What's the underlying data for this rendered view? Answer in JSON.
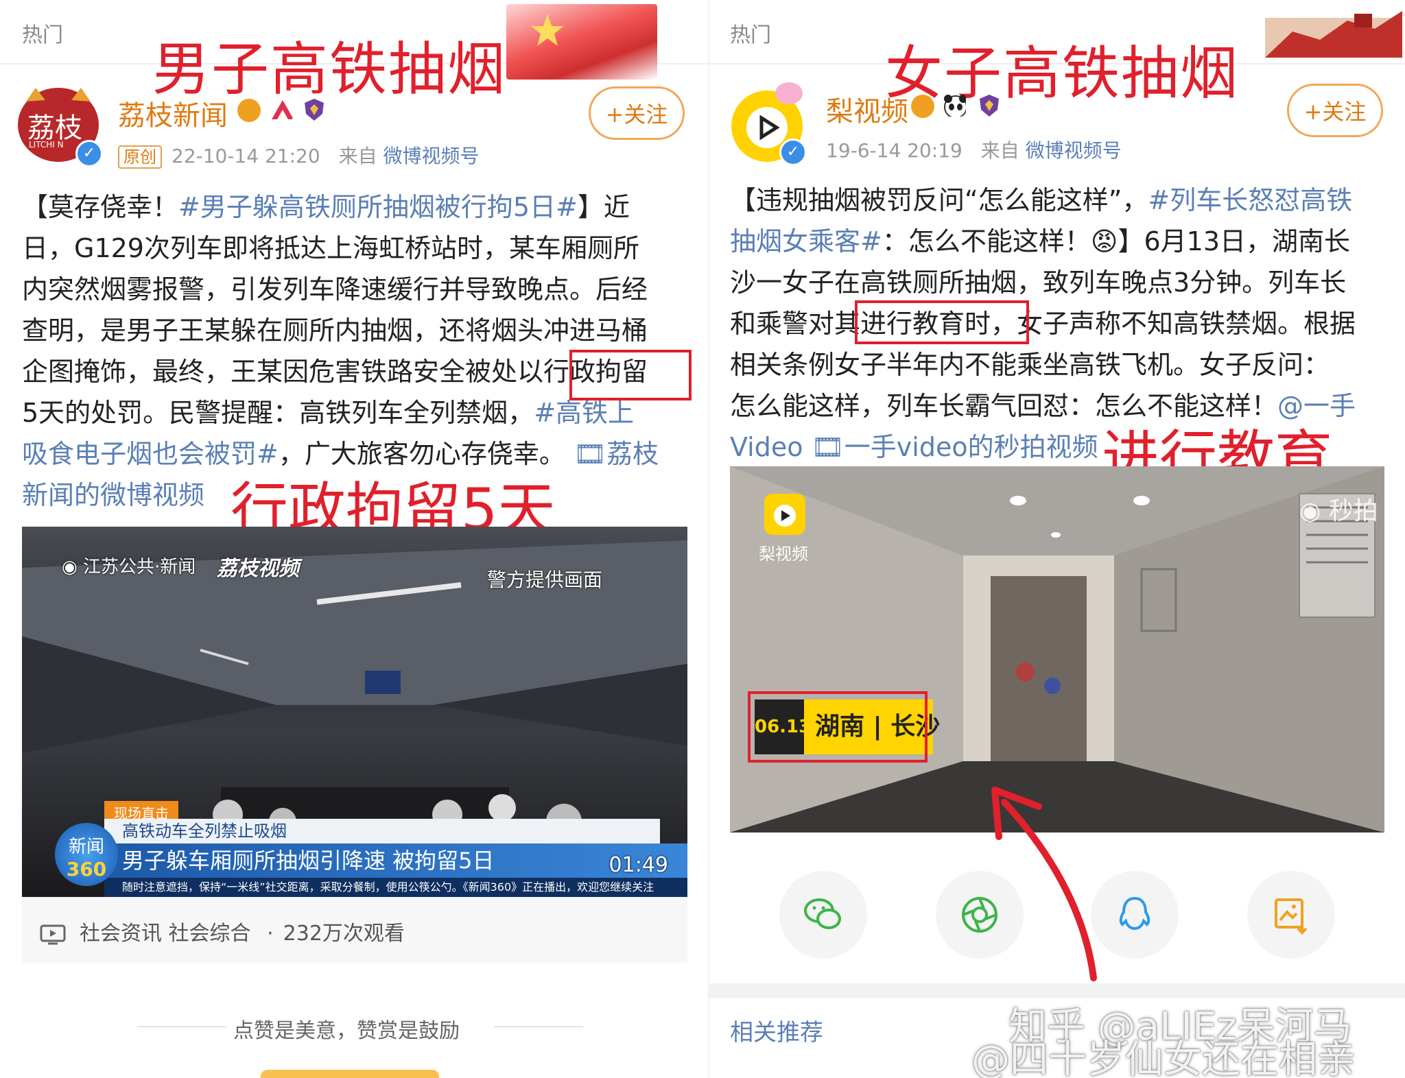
{
  "left": {
    "hot_label": "热门",
    "overlay_title": "男子高铁抽烟",
    "account": {
      "name": "荔枝新闻",
      "avatar_text": "荔枝",
      "avatar_sub": "LITCHI N"
    },
    "follow_label": "+关注",
    "original_badge": "原创",
    "timestamp": "22-10-14 21:20",
    "from_label": "来自",
    "source": "微博视频号",
    "body_lines": [
      [
        "【莫存侥幸！",
        "#男子躲高铁厕所抽烟被行拘5日#",
        "】近"
      ],
      [
        "日，G129次列车即将抵达上海虹桥站时，某车厢厕所"
      ],
      [
        "内突然烟雾报警，引发列车降速缓行并导致晚点。后经"
      ],
      [
        "查明，是男子王某躲在厕所内抽烟，还将烟头冲进马桶"
      ],
      [
        "企图掩饰，最终，王某因危害铁路安全被处以",
        "行政拘留"
      ],
      [
        "5天的处罚。民警提醒：高铁列车全列禁烟，",
        "#高铁上"
      ],
      [
        "吸食电子烟也会被罚#",
        "，广大旅客勿心存侥幸。",
        " 🎞荔枝"
      ],
      [
        "新闻的微博视频"
      ]
    ],
    "annotation": "行政拘留5天",
    "video": {
      "logo1": "江苏公共·新闻",
      "logo2": "荔枝视频",
      "police_caption": "警方提供画面",
      "live_tag": "现场直击",
      "subheadline": "高铁动车全列禁止吸烟",
      "headline": "男子躲车厢厕所抽烟引降速 被拘留5日",
      "ticker": "随时注意遮挡，保持“一米线”社交距离，采取分餐制，使用公筷公勺。《新闻360》正在播出，欢迎您继续关注",
      "news_logo_top": "新闻",
      "news_logo_bottom": "360",
      "duration": "01:49"
    },
    "video_category": "社会资讯 社会综合",
    "dot": "·",
    "views": "232万次观看",
    "bottom_hint": "点赞是美意，赞赏是鼓励"
  },
  "right": {
    "hot_label": "热门",
    "overlay_title": "女子高铁抽烟",
    "account": {
      "name": "梨视频"
    },
    "follow_label": "+关注",
    "timestamp": "19-6-14 20:19",
    "from_label": "来自",
    "source": "微博视频号",
    "body_lines": [
      [
        "【违规抽烟被罚反问“怎么能这样”，",
        "#列车长怒怼高铁"
      ],
      [
        "抽烟女乘客#",
        "：怎么不能这样！😡】6月13日，湖南长"
      ],
      [
        "沙一女子在高铁厕所抽烟，致列车晚点3分钟。列车长"
      ],
      [
        "和乘警对其",
        "进行教育时",
        "，女子声称不知高铁禁烟。根据"
      ],
      [
        "相关条例女子半年内不能乘坐高铁飞机。女子反问："
      ],
      [
        "怎么能这样，列车长霸气回怼：怎么不能这样！",
        "@一手"
      ],
      [
        "Video",
        " 🎞一手video的秒拍视频"
      ]
    ],
    "annotation": "进行教育",
    "video": {
      "logo": "梨视频",
      "watermark": "秒拍",
      "date": "06.13",
      "location": "湖南 | 长沙"
    },
    "related": "相关推荐",
    "watermark_zhihu": "知乎 @aLIEz呆河马",
    "watermark_weibo": "@四十岁仙女还在相亲"
  },
  "icons": [
    "wechat-icon",
    "moments-icon",
    "qq-icon",
    "save-image-icon",
    "play-icon",
    "video-icon"
  ],
  "colors": {
    "accent": "#e07a10",
    "link": "#5a7fb5",
    "annotation": "#e0202c"
  }
}
